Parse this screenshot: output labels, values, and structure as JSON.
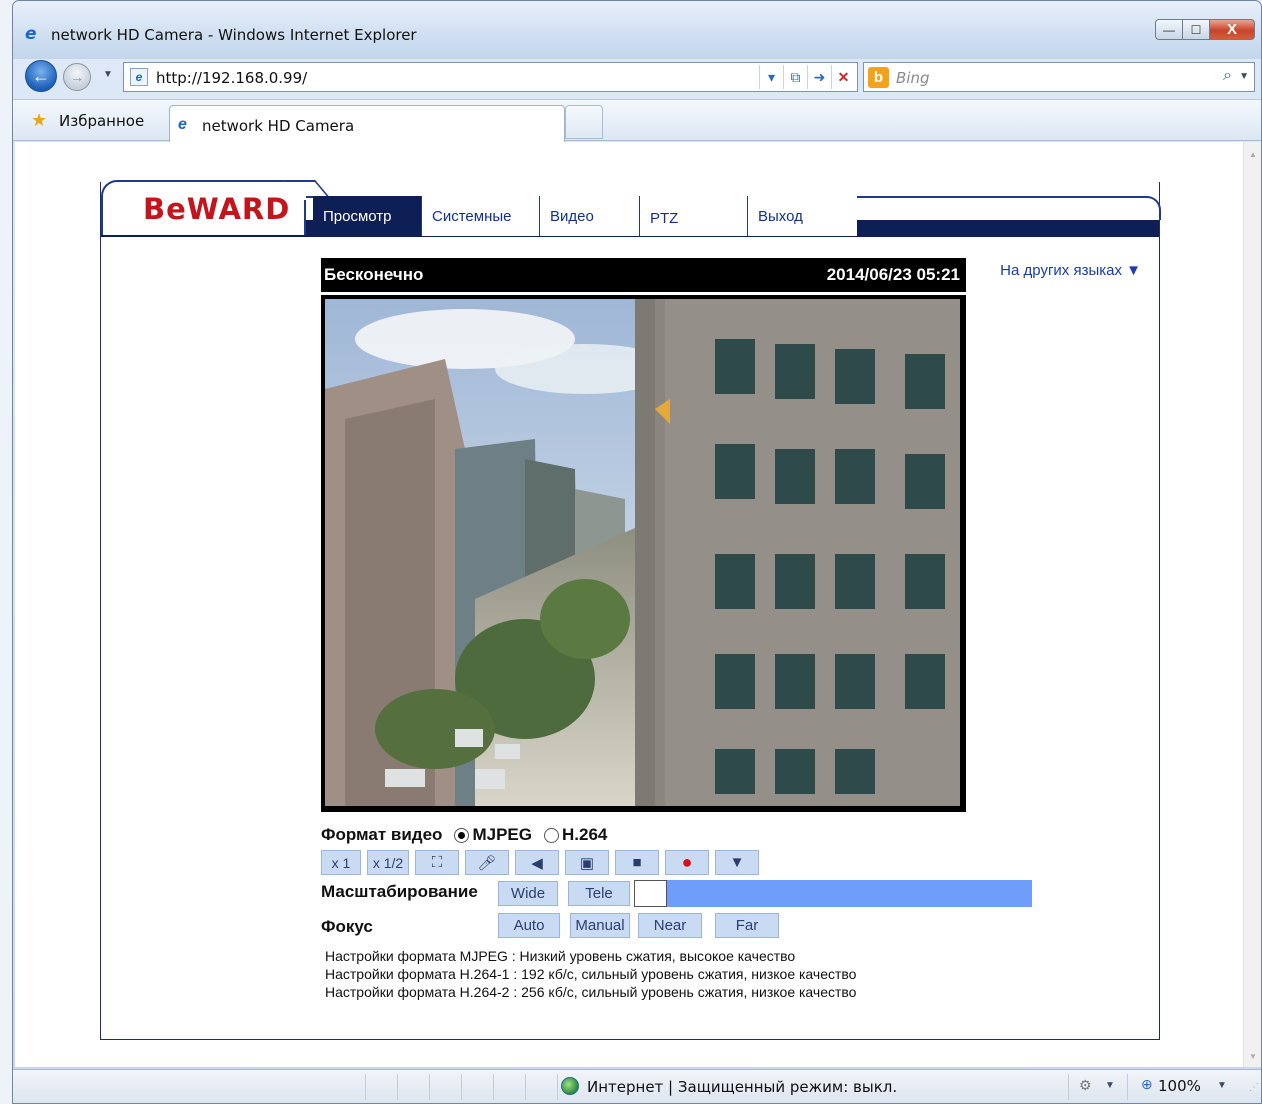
{
  "window": {
    "title": "network HD Camera - Windows Internet Explorer",
    "controls": {
      "minimize": "—",
      "maximize": "☐",
      "close": "X"
    }
  },
  "toolbar": {
    "address": "http://192.168.0.99/",
    "search_placeholder": "Bing"
  },
  "favorites": {
    "label": "Избранное",
    "tab_title": "network HD Camera"
  },
  "page": {
    "logo": "BeWARD",
    "nav": [
      "Просмотр",
      "Системные",
      "Видео",
      "PTZ",
      "Выход"
    ],
    "language": "На других языках ▼",
    "video": {
      "title_left": "Бесконечно",
      "timestamp": "2014/06/23 05:21"
    },
    "format": {
      "label": "Формат видео",
      "options": [
        "MJPEG",
        "H.264"
      ],
      "selected": "MJPEG"
    },
    "controls": {
      "zoom_1": "x 1",
      "zoom_half": "x 1/2",
      "icons": [
        "fullscreen-icon",
        "microphone-icon",
        "speaker-icon",
        "snapshot-icon",
        "stop-icon",
        "record-icon",
        "dropdown-icon"
      ]
    },
    "scaling": {
      "label": "Масштабирование",
      "wide": "Wide",
      "tele": "Tele",
      "level": 0.0
    },
    "focus": {
      "label": "Фокус",
      "auto": "Auto",
      "manual": "Manual",
      "near": "Near",
      "far": "Far"
    },
    "info": [
      "Настройки формата MJPEG : Низкий уровень сжатия, высокое качество",
      "Настройки формата H.264-1 : 192 кб/с, сильный уровень сжатия, низкое качество",
      "Настройки формата H.264-2 : 256 кб/с, сильный уровень сжатия, низкое качество"
    ]
  },
  "statusbar": {
    "text": "Интернет | Защищенный режим: выкл.",
    "zoom": "100%"
  }
}
